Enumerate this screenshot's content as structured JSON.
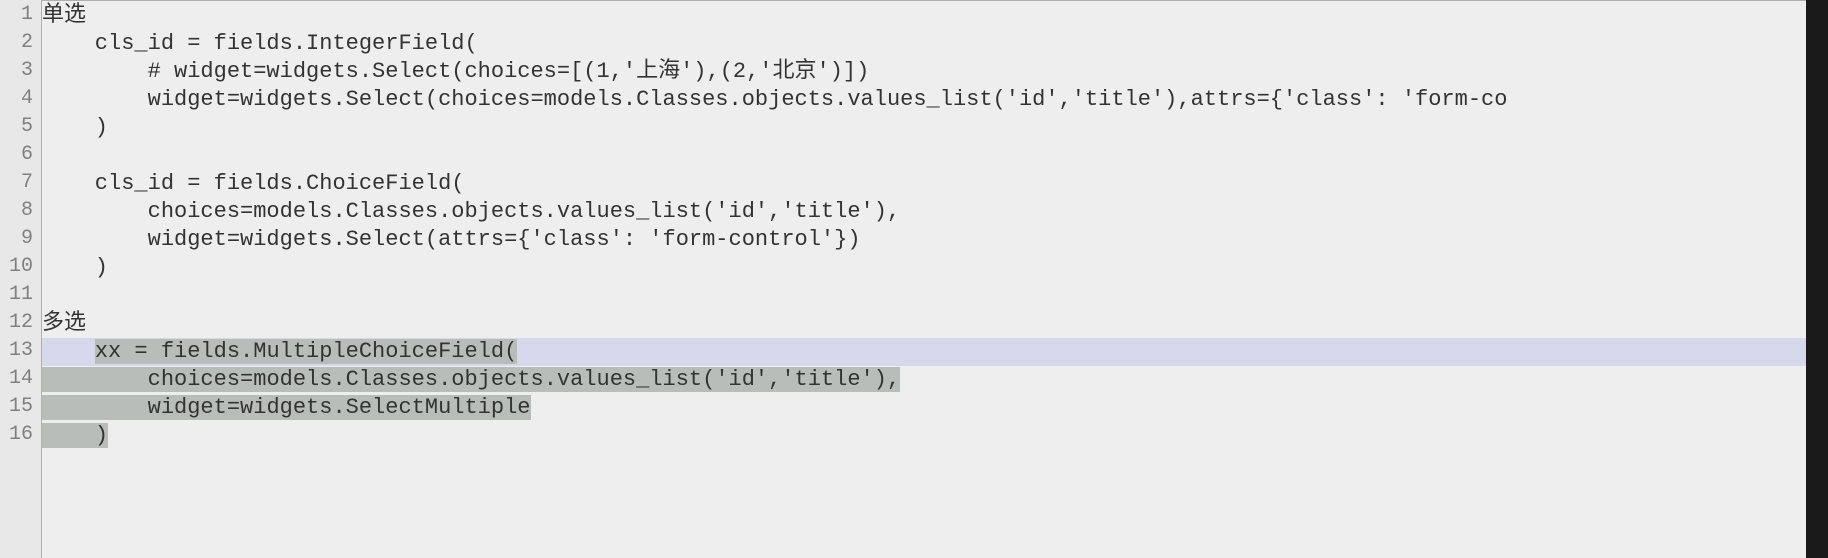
{
  "editor": {
    "gutter": [
      "1",
      "2",
      "3",
      "4",
      "5",
      "6",
      "7",
      "8",
      "9",
      "10",
      "11",
      "12",
      "13",
      "14",
      "15",
      "16"
    ],
    "lines": [
      {
        "n": 1,
        "text": "单选",
        "prefix": ""
      },
      {
        "n": 2,
        "text": "    cls_id = fields.IntegerField(",
        "prefix": ""
      },
      {
        "n": 3,
        "text": "        # widget=widgets.Select(choices=[(1,'上海'),(2,'北京')])",
        "prefix": ""
      },
      {
        "n": 4,
        "text": "        widget=widgets.Select(choices=models.Classes.objects.values_list('id','title'),attrs={'class': 'form-co",
        "prefix": ""
      },
      {
        "n": 5,
        "text": "    )",
        "prefix": ""
      },
      {
        "n": 6,
        "text": "",
        "prefix": ""
      },
      {
        "n": 7,
        "text": "    cls_id = fields.ChoiceField(",
        "prefix": ""
      },
      {
        "n": 8,
        "text": "        choices=models.Classes.objects.values_list('id','title'),",
        "prefix": ""
      },
      {
        "n": 9,
        "text": "        widget=widgets.Select(attrs={'class': 'form-control'})",
        "prefix": ""
      },
      {
        "n": 10,
        "text": "    )",
        "prefix": ""
      },
      {
        "n": 11,
        "text": "",
        "prefix": ""
      },
      {
        "n": 12,
        "text": "多选",
        "prefix": ""
      },
      {
        "n": 13,
        "text": "    xx = fields.MultipleChoiceField(",
        "prefix": "",
        "highlighted": true,
        "sel_from": "xx = fields.MultipleChoiceField("
      },
      {
        "n": 14,
        "text": "        choices=models.Classes.objects.values_list('id','title'),",
        "prefix": "",
        "sel": "choices=models.Classes.objects.values_list('id','title'),"
      },
      {
        "n": 15,
        "text": "        widget=widgets.SelectMultiple",
        "prefix": "",
        "sel": "widget=widgets.SelectMultiple"
      },
      {
        "n": 16,
        "text": "    )",
        "prefix": "",
        "sel": ")"
      }
    ]
  }
}
